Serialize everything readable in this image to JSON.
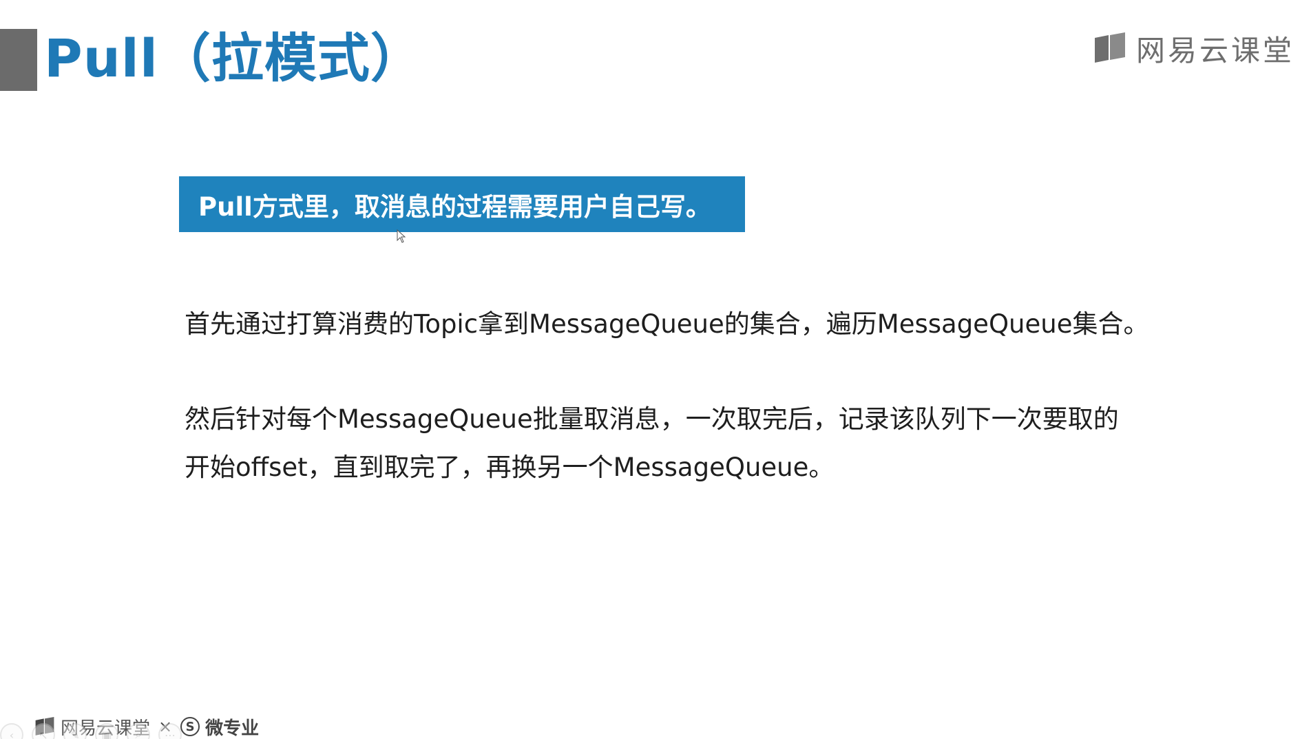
{
  "slide": {
    "title": "Pull（拉模式）",
    "brand_top": "网易云课堂",
    "callout": "Pull方式里，取消息的过程需要用户自己写。",
    "paragraph_1": "首先通过打算消费的Topic拿到MessageQueue的集合，遍历MessageQueue集合。",
    "paragraph_2_line_1": "然后针对每个MessageQueue批量取消息，一次取完后，记录该队列下一次要取的",
    "paragraph_2_line_2": "开始offset，直到取完了，再换另一个MessageQueue。"
  },
  "footer": {
    "brand": "网易云课堂",
    "separator": "×",
    "badge": "S",
    "partner": "微专业"
  },
  "controls": {
    "prev": "‹",
    "pointer": "↖",
    "pen": "✎",
    "slides": "▣",
    "zoom": "⌕",
    "more": "⋯"
  },
  "colors": {
    "title_blue": "#1f79b6",
    "callout_blue": "#1f83bd",
    "accent_gray": "#6b6b6b"
  },
  "icons": {
    "brand_logo": "book-logo-icon",
    "cursor": "mouse-pointer-icon"
  }
}
